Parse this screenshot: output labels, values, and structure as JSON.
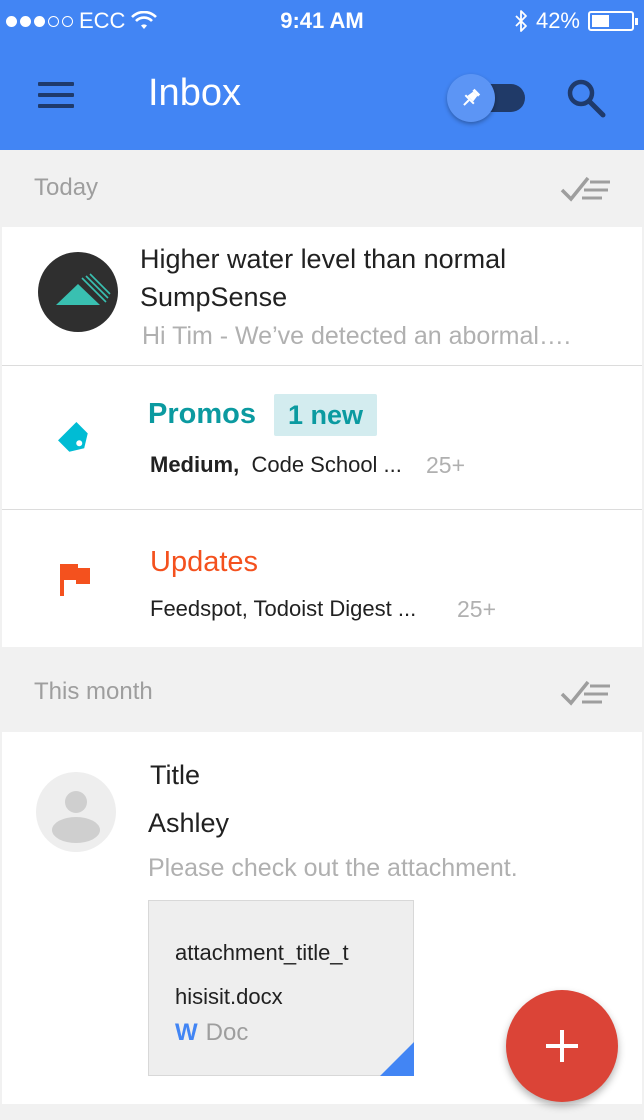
{
  "status": {
    "carrier": "ECC",
    "time": "9:41 AM",
    "battery": "42%",
    "battery_level": 0.42,
    "signal_bars_filled": 3,
    "signal_bars_total": 5
  },
  "appbar": {
    "title": "Inbox",
    "pin_toggle_on": false
  },
  "sections": {
    "today": "Today",
    "this_month": "This month"
  },
  "message1": {
    "title": "Higher water level than normal",
    "sender": "SumpSense",
    "snippet": "Hi Tim - We’ve detected an abormal…."
  },
  "promos": {
    "label": "Promos",
    "badge": "1 new",
    "sender_bold": "Medium,",
    "senders_rest": "Code School ...",
    "count": "25+"
  },
  "updates": {
    "label": "Updates",
    "senders": "Feedspot, Todoist Digest ...",
    "count": "25+"
  },
  "message2": {
    "title": "Title",
    "sender": "Ashley",
    "snippet": "Please check out the attachment.",
    "attachment": {
      "line1": "attachment_title_t",
      "line2": "hisisit.docx",
      "type_icon": "W",
      "type": "Doc"
    }
  },
  "colors": {
    "primary": "#4285f4",
    "promos": "#0b9aa0",
    "updates": "#f4511e",
    "fab": "#db4437"
  },
  "icons": {
    "menu": "menu-icon",
    "pin": "pin-icon",
    "search": "search-icon",
    "sweep": "sweep-icon",
    "tag": "tag-icon",
    "flag": "flag-icon",
    "compose": "plus-icon"
  }
}
